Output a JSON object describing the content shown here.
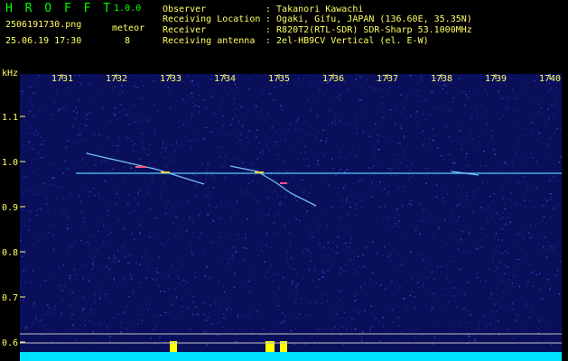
{
  "header": {
    "app_name": "H R O F F T",
    "version": "1.0.0",
    "filename": "2506191730.png",
    "datetime": "25.06.19 17:30",
    "meteor_label": "meteor",
    "meteor_count": "8",
    "info": [
      {
        "label": "Observer",
        "value": ": Takanori Kawachi"
      },
      {
        "label": "Receiving Location",
        "value": ": Ogaki, Gifu, JAPAN (136.60E, 35.35N)"
      },
      {
        "label": "Receiver",
        "value": ": R820T2(RTL-SDR) SDR-Sharp 53.1000MHz"
      },
      {
        "label": "Receiving antenna",
        "value": ": 2el-HB9CV Vertical (el. E-W)"
      }
    ]
  },
  "spectrogram": {
    "y_unit": "kHz",
    "time_ticks": [
      "1731",
      "1732",
      "1733",
      "1734",
      "1735",
      "1736",
      "1737",
      "1738",
      "1739",
      "1740"
    ],
    "freq_ticks": [
      "1.1",
      "1.0",
      "0.9",
      "0.8",
      "0.7",
      "0.6"
    ],
    "colors": {
      "label": "#ffff66",
      "title": "#00ff00",
      "background": "#0a0f5a",
      "carrier": "#55ccff",
      "baseline": "#00e0ff",
      "burst": "#ffff00"
    }
  }
}
